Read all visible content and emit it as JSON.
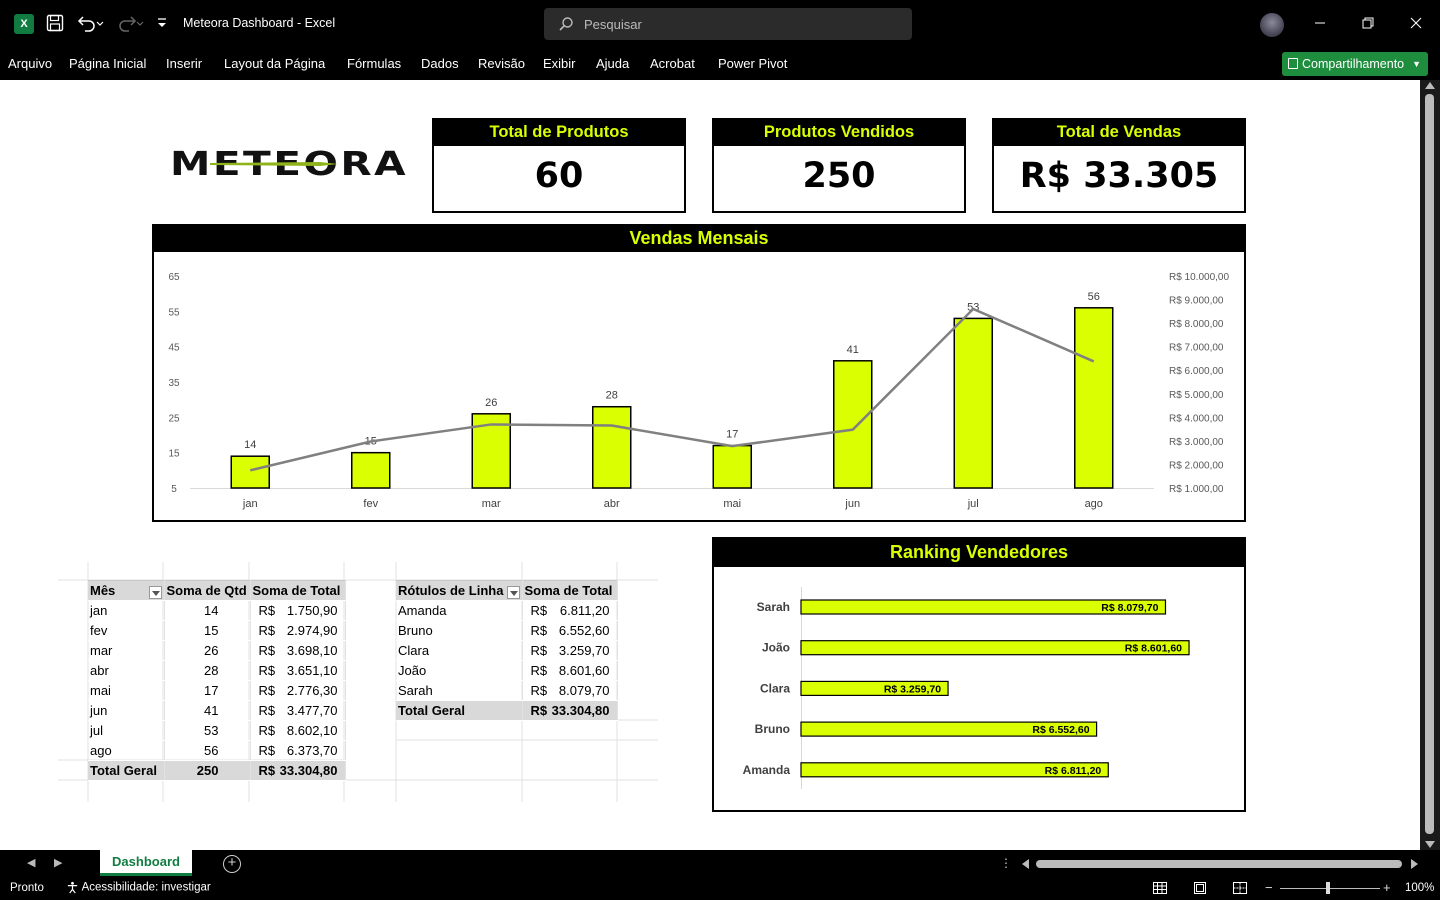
{
  "window": {
    "doc_title": "Meteora Dashboard  -  Excel",
    "search_placeholder": "Pesquisar"
  },
  "menu": {
    "items": [
      "Arquivo",
      "Página Inicial",
      "Inserir",
      "Layout da Página",
      "Fórmulas",
      "Dados",
      "Revisão",
      "Exibir",
      "Ajuda",
      "Acrobat",
      "Power Pivot"
    ],
    "share_label": "Compartilhamento"
  },
  "dashboard": {
    "logo_text": "METEORA",
    "kpis": [
      {
        "title": "Total de Produtos",
        "value": "60"
      },
      {
        "title": "Produtos Vendidos",
        "value": "250"
      },
      {
        "title": "Total de Vendas",
        "value": "R$ 33.305"
      }
    ],
    "ranking_title": "Ranking Vendedores"
  },
  "chart_data": [
    {
      "type": "bar",
      "title": "Vendas Mensais",
      "categories": [
        "jan",
        "fev",
        "mar",
        "abr",
        "mai",
        "jun",
        "jul",
        "ago"
      ],
      "series": [
        {
          "values": [
            14,
            15,
            26,
            28,
            17,
            41,
            53,
            56
          ],
          "color": "#d9ff00",
          "axis": "left"
        },
        {
          "type": "line",
          "values": [
            1750.9,
            2974.9,
            3698.1,
            3651.1,
            2776.3,
            3477.7,
            8602.1,
            6373.7
          ],
          "color": "#808080",
          "axis": "right"
        }
      ],
      "ylim": [
        5,
        65
      ],
      "yticks": [
        "5",
        "15",
        "25",
        "35",
        "45",
        "55",
        "65"
      ],
      "y2lim": [
        1000,
        10000
      ],
      "y2ticks": [
        "R$ 1.000,00",
        "R$ 2.000,00",
        "R$ 3.000,00",
        "R$ 4.000,00",
        "R$ 5.000,00",
        "R$ 6.000,00",
        "R$ 7.000,00",
        "R$ 8.000,00",
        "R$ 9.000,00",
        "R$ 10.000,00"
      ],
      "data_labels": [
        "14",
        "15",
        "26",
        "28",
        "17",
        "41",
        "53",
        "56"
      ],
      "grid": false,
      "legend": "none"
    },
    {
      "type": "bar",
      "orientation": "horizontal",
      "title": "Ranking Vendedores",
      "categories": [
        "Sarah",
        "João",
        "Clara",
        "Bruno",
        "Amanda"
      ],
      "values": [
        8079.7,
        8601.6,
        3259.7,
        6552.6,
        6811.2
      ],
      "data_labels": [
        "R$ 8.079,70",
        "R$ 8.601,60",
        "R$ 3.259,70",
        "R$ 6.552,60",
        "R$ 6.811,20"
      ],
      "xlim": [
        0,
        9000
      ],
      "color": "#d9ff00"
    }
  ],
  "pivot_months": {
    "headers": [
      "Mês",
      "Soma de Qtd",
      "Soma de Total"
    ],
    "rows": [
      {
        "mes": "jan",
        "qtd": "14",
        "cur": "R$",
        "total": "1.750,90"
      },
      {
        "mes": "fev",
        "qtd": "15",
        "cur": "R$",
        "total": "2.974,90"
      },
      {
        "mes": "mar",
        "qtd": "26",
        "cur": "R$",
        "total": "3.698,10"
      },
      {
        "mes": "abr",
        "qtd": "28",
        "cur": "R$",
        "total": "3.651,10"
      },
      {
        "mes": "mai",
        "qtd": "17",
        "cur": "R$",
        "total": "2.776,30"
      },
      {
        "mes": "jun",
        "qtd": "41",
        "cur": "R$",
        "total": "3.477,70"
      },
      {
        "mes": "jul",
        "qtd": "53",
        "cur": "R$",
        "total": "8.602,10"
      },
      {
        "mes": "ago",
        "qtd": "56",
        "cur": "R$",
        "total": "6.373,70"
      }
    ],
    "total": {
      "label": "Total Geral",
      "qtd": "250",
      "cur": "R$",
      "total": "33.304,80"
    }
  },
  "pivot_sellers": {
    "headers": [
      "Rótulos de Linha",
      "Soma de Total"
    ],
    "rows": [
      {
        "nome": "Amanda",
        "cur": "R$",
        "total": "6.811,20"
      },
      {
        "nome": "Bruno",
        "cur": "R$",
        "total": "6.552,60"
      },
      {
        "nome": "Clara",
        "cur": "R$",
        "total": "3.259,70"
      },
      {
        "nome": "João",
        "cur": "R$",
        "total": "8.601,60"
      },
      {
        "nome": "Sarah",
        "cur": "R$",
        "total": "8.079,70"
      }
    ],
    "total": {
      "label": "Total Geral",
      "cur": "R$",
      "total": "33.304,80"
    }
  },
  "tabs": {
    "active": "Dashboard"
  },
  "status": {
    "ready": "Pronto",
    "accessibility": "Acessibilidade: investigar",
    "zoom": "100%"
  },
  "colors": {
    "accent": "#d9ff00",
    "excel_green": "#107c41",
    "share_green": "#1e8e3e"
  }
}
